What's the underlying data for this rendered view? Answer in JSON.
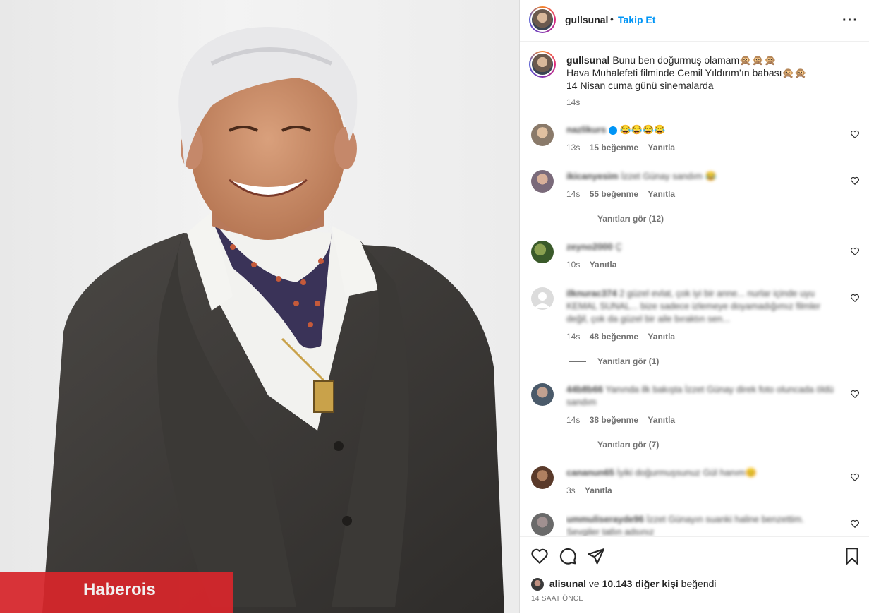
{
  "post": {
    "author": "gullsunal",
    "follow_label": "Takip Et",
    "more_label": "•••",
    "separator": "•",
    "caption_lines": [
      "Bunu ben doğurmuş olamam🙊🙊🙊",
      "Hava Muhalefeti filminde Cemil Yıldırım’ın babası🙊🙊",
      "14 Nisan cuma günü sinemalarda"
    ],
    "caption_time": "14s"
  },
  "comments": [
    {
      "user": "nazlikurs",
      "verified": true,
      "text": "😂😂😂😂",
      "time": "13s",
      "likes": "15 beğenme",
      "reply": "Yanıtla",
      "avatar": "#8a7a6a"
    },
    {
      "user": "ikicanyesim",
      "text": "İzzet Günay sandım 😂",
      "time": "14s",
      "likes": "55 beğenme",
      "reply": "Yanıtla",
      "avatar": "#7a6a7a",
      "replies": "Yanıtları gör (12)"
    },
    {
      "user": "zeyno2000",
      "text": "Ç",
      "time": "10s",
      "likes": "",
      "reply": "Yanıtla",
      "avatar": "#5a7a3a"
    },
    {
      "user": "ilknurac374",
      "text": "2 güzel evlat, çok iyi bir anne... nurlar içinde uyu KEMAL SUNAL... bize sadece izlemeye doyamadığımız filmler değil, çok da güzel bir aile bıraktın sen...",
      "time": "14s",
      "likes": "48 beğenme",
      "reply": "Yanıtla",
      "avatar": "#d0d0d0",
      "replies": "Yanıtları gör (1)"
    },
    {
      "user": "44b8b66",
      "text": "Yanında ilk bakışta İzzet Günay direk foto oluncada öldü sandım",
      "time": "14s",
      "likes": "38 beğenme",
      "reply": "Yanıtla",
      "avatar": "#4a5a6a",
      "replies": "Yanıtları gör (7)"
    },
    {
      "user": "cananun65",
      "text": "İyiki doğurmuşsunuz Gül hanım😊",
      "time": "3s",
      "likes": "",
      "reply": "Yanıtla",
      "avatar": "#5a3a2a"
    },
    {
      "user": "ummuliserayde96",
      "text": "İzzet Günayın suanki haline benzettim. Sevgiler tatlın adsınız",
      "time": "",
      "likes": "",
      "reply": "",
      "avatar": "#6a6a6a"
    }
  ],
  "likes_summary": {
    "user": "alisunal",
    "middle": " ve ",
    "count": "10.143 diğer kişi",
    "suffix": " beğendi"
  },
  "time_ago": "14 SAAT ÖNCE",
  "watermark": "Haberois",
  "colors": {
    "accent": "#0095f6",
    "watermark": "#d7262b"
  }
}
